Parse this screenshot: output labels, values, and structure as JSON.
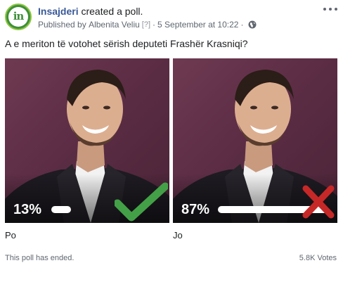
{
  "post": {
    "page_name": "Insajderi",
    "action": " created a poll.",
    "published_by_prefix": "Published by ",
    "author": "Albenita Veliu",
    "help_marker": "[?]",
    "separator": "·",
    "date": "5 September at 10:22",
    "privacy_icon": "globe-icon",
    "more_icon": "more-options-icon",
    "avatar_logo_text": "in"
  },
  "poll": {
    "question": "A e meriton të votohet sërish deputeti Frashër Krasniqi?",
    "options": [
      {
        "label": "Po",
        "percent_text": "13%",
        "percent_value": 13,
        "mark": "check-icon",
        "mark_color": "#4caf50"
      },
      {
        "label": "Jo",
        "percent_text": "87%",
        "percent_value": 87,
        "mark": "cross-icon",
        "mark_color": "#c62828"
      }
    ],
    "status": "This poll has ended.",
    "votes": "5.8K Votes"
  },
  "colors": {
    "link": "#385898",
    "secondary_text": "#606770",
    "photo_background": "#5c2d45",
    "avatar_green": "#3f8f3a"
  }
}
